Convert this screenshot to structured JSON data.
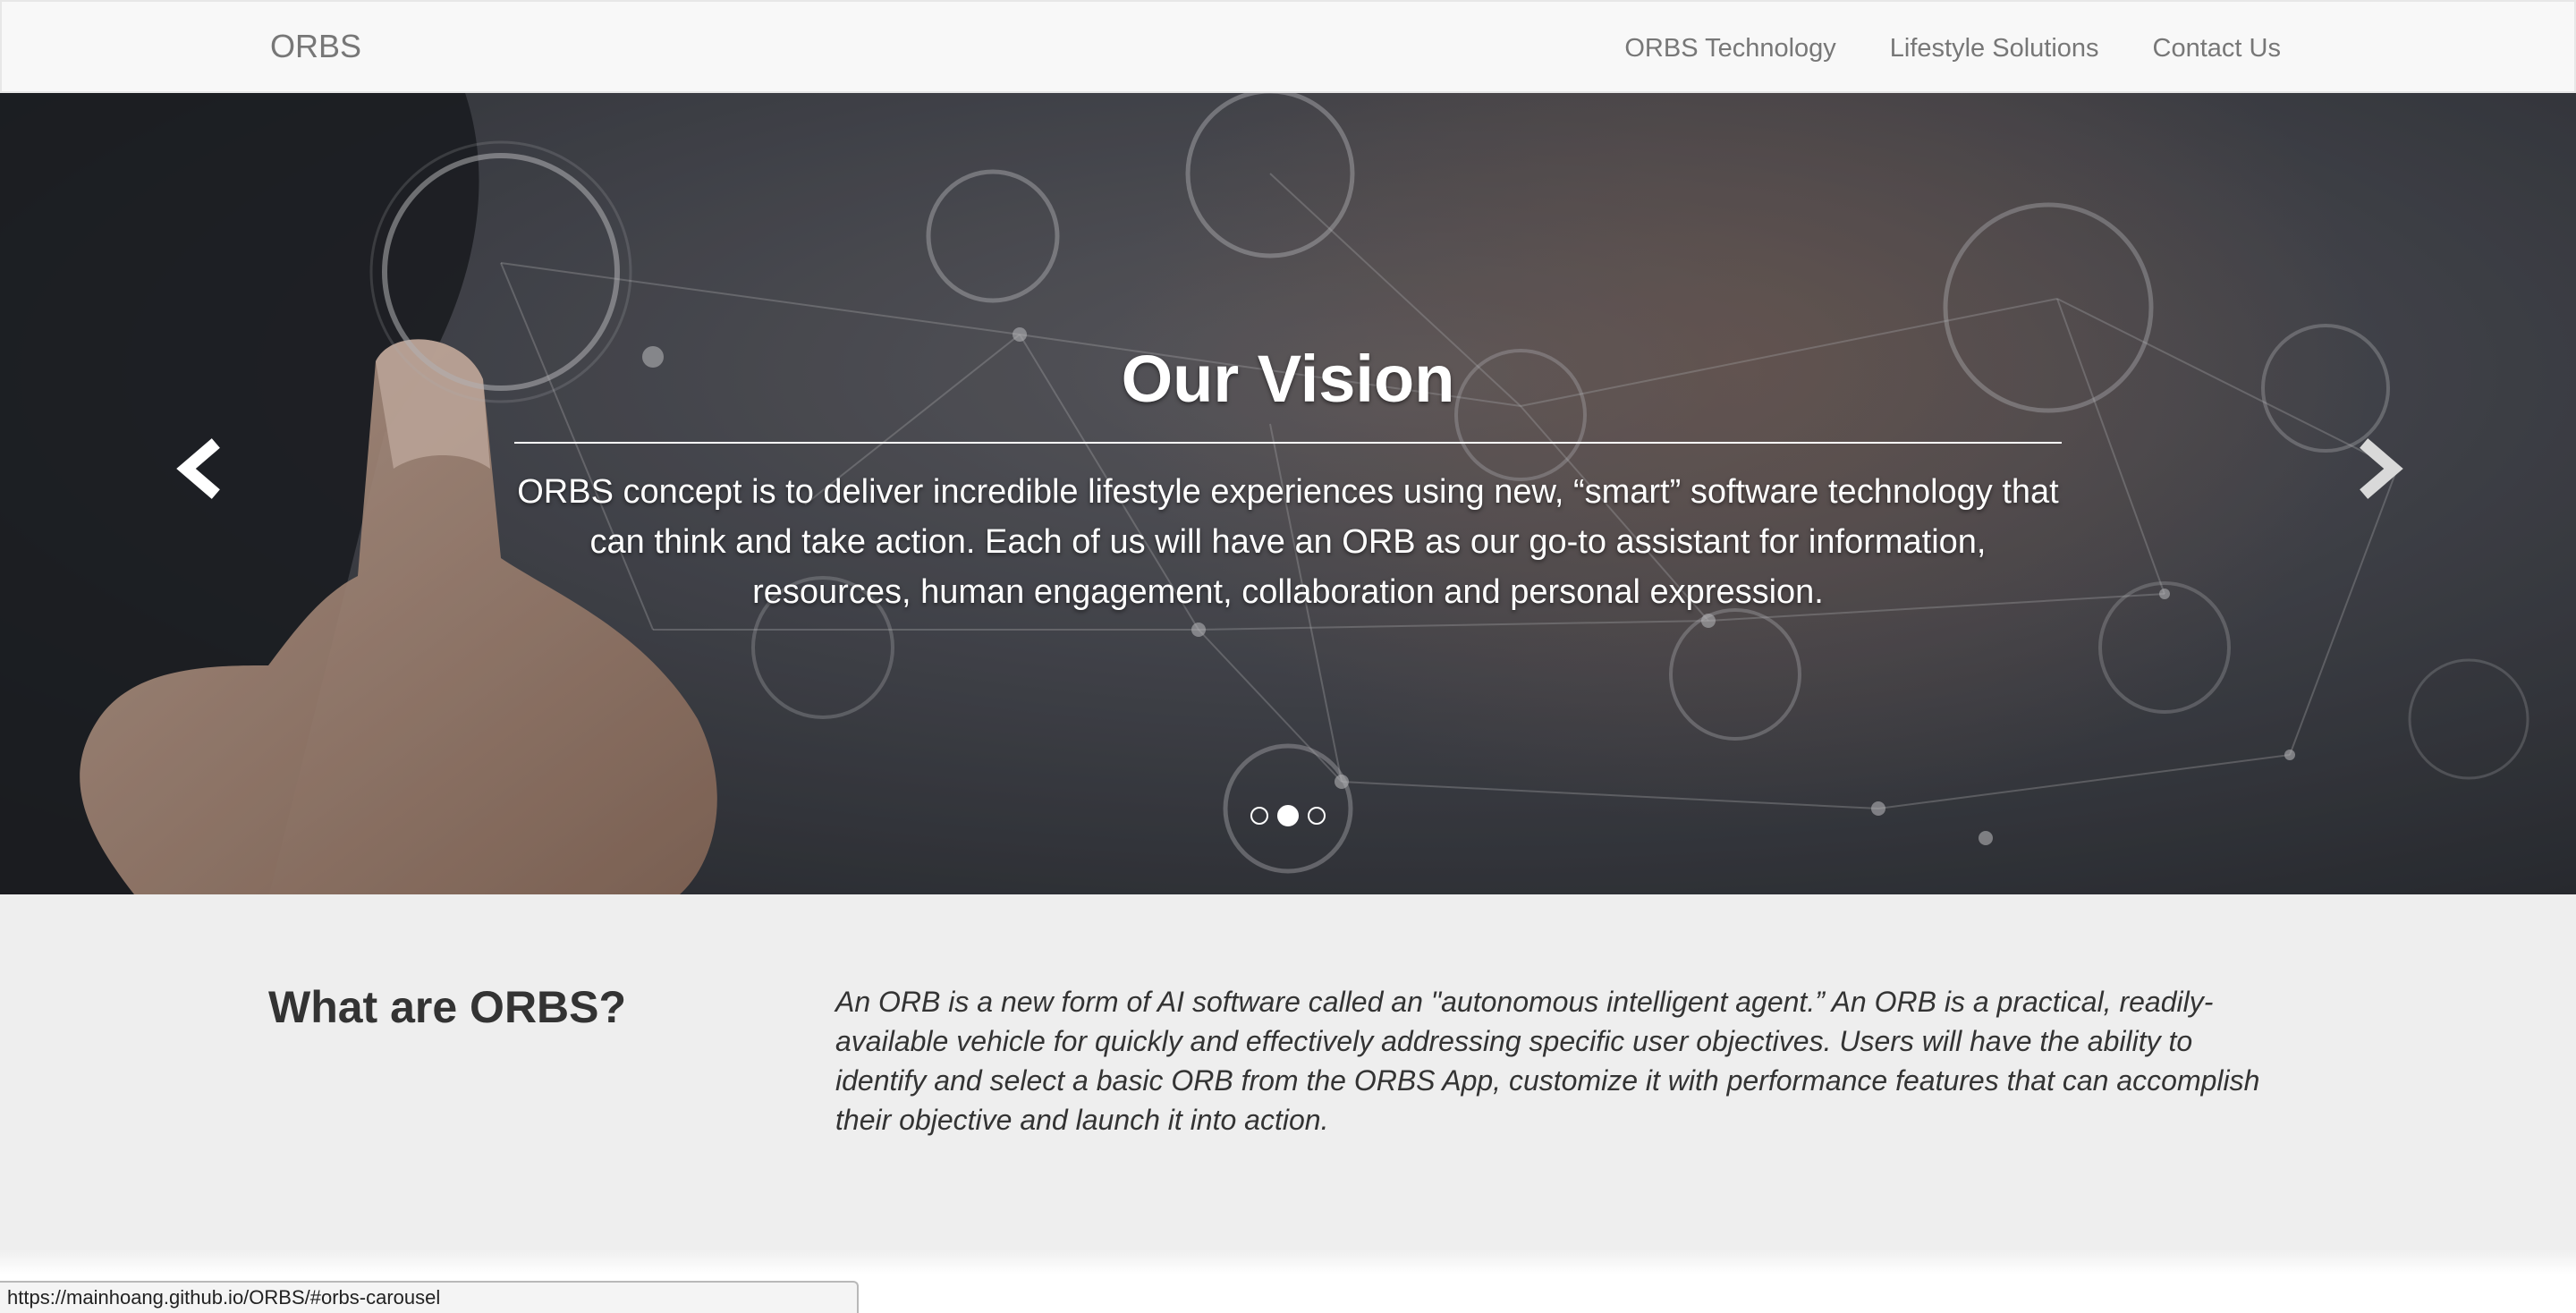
{
  "navbar": {
    "brand": "ORBS",
    "links": [
      {
        "label": "ORBS Technology"
      },
      {
        "label": "Lifestyle Solutions"
      },
      {
        "label": "Contact Us"
      }
    ]
  },
  "carousel": {
    "title": "Our Vision",
    "text": "ORBS concept is to deliver incredible lifestyle experiences using new, “smart” software technology that can think and take action. Each of us will have an ORB as our go-to assistant for information, resources, human engagement, collaboration and personal expression.",
    "prev_icon": "chevron-left-icon",
    "next_icon": "chevron-right-icon",
    "slide_count": 3,
    "active_slide": 2
  },
  "about": {
    "heading": "What are ORBS?",
    "text": "An ORB is a new form of AI software called an \"autonomous intelligent agent.” An ORB is a practical, readily-available vehicle for quickly and effectively addressing specific user objectives. Users will have the ability to identify and select a basic ORB from the ORBS App, customize it with performance features that can accomplish their objective and launch it into action."
  },
  "status_bar": {
    "url": "https://mainhoang.github.io/ORBS/#orbs-carousel"
  },
  "colors": {
    "navbar_bg": "#f8f8f8",
    "nav_text": "#777777",
    "about_bg": "#eeeeee",
    "heading_text": "#333333"
  }
}
